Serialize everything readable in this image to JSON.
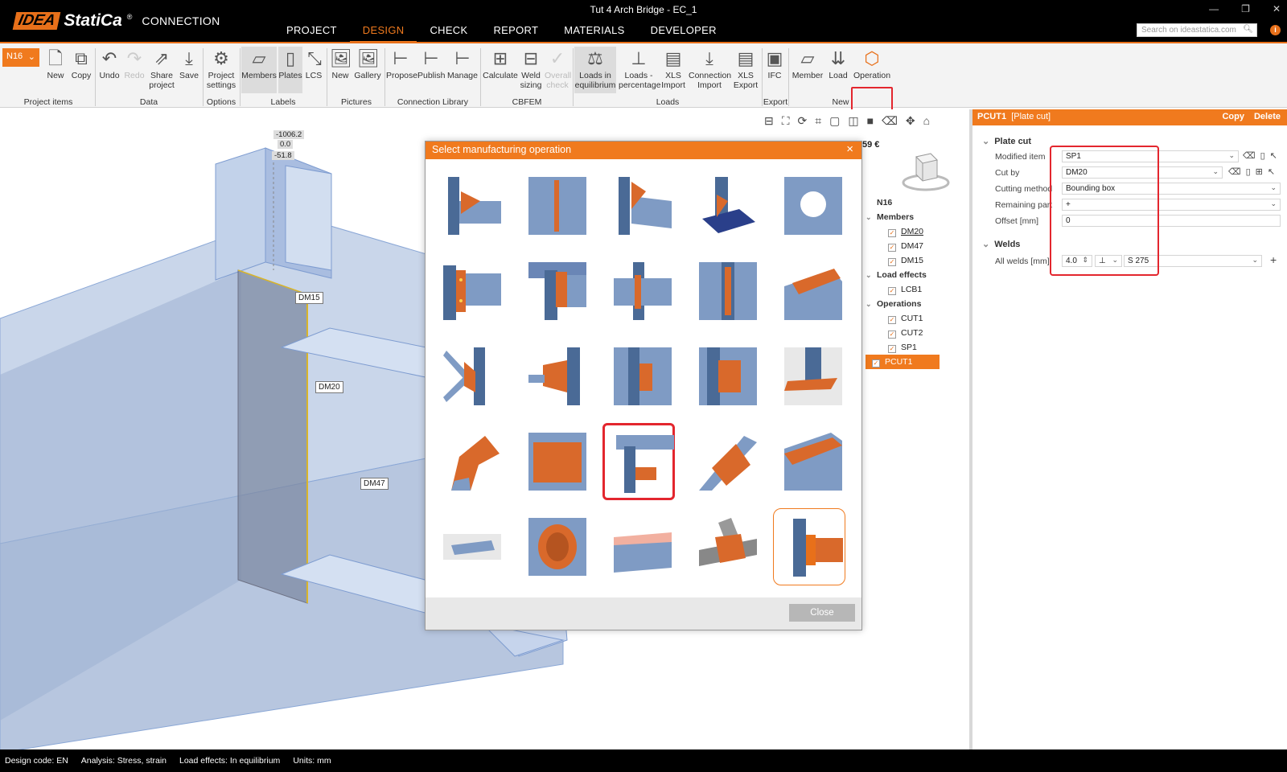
{
  "app": {
    "logo": "IDEA",
    "logo_statica": "StatiCa",
    "logo_reg": "®",
    "product": "CONNECTION",
    "window_title": "Tut 4 Arch Bridge - EC_1",
    "window_controls": [
      "—",
      "❐",
      "✕"
    ]
  },
  "menu": {
    "items": [
      "PROJECT",
      "DESIGN",
      "CHECK",
      "REPORT",
      "MATERIALS",
      "DEVELOPER"
    ],
    "active": "DESIGN"
  },
  "search": {
    "placeholder": "Search on ideastatica.com"
  },
  "ribbon": {
    "node_selector": "N16",
    "buttons": {
      "new": "New",
      "copy": "Copy",
      "undo": "Undo",
      "redo": "Redo",
      "share": "Share project",
      "save": "Save",
      "project_settings": "Project settings",
      "members": "Members",
      "plates": "Plates",
      "lcs": "LCS",
      "pic_new": "New",
      "gallery": "Gallery",
      "propose": "Propose",
      "publish": "Publish",
      "manage": "Manage",
      "calculate": "Calculate",
      "weld_sizing": "Weld sizing",
      "overall_check": "Overall check",
      "loads_eq": "Loads in equilibrium",
      "loads_pct": "Loads - percentage",
      "xls_import": "XLS Import",
      "conn_import": "Connection Import",
      "xls_export": "XLS Export",
      "ifc": "IFC",
      "member": "Member",
      "load": "Load",
      "operation": "Operation"
    },
    "groups": [
      "Project items",
      "Data",
      "Options",
      "Labels",
      "Pictures",
      "Connection Library",
      "CBFEM",
      "Loads",
      "Export",
      "New"
    ]
  },
  "viewport": {
    "labels": [
      "DM15",
      "DM20",
      "DM47"
    ],
    "dims": [
      "-1006.2",
      "0.0",
      "-51.8"
    ],
    "price": "59 €"
  },
  "tree": {
    "root": "N16",
    "sections": [
      {
        "title": "Members",
        "items": [
          "DM20",
          "DM47",
          "DM15"
        ]
      },
      {
        "title": "Load effects",
        "items": [
          "LCB1"
        ]
      },
      {
        "title": "Operations",
        "items": [
          "CUT1",
          "CUT2",
          "SP1",
          "PCUT1"
        ]
      }
    ],
    "selected": "PCUT1"
  },
  "props": {
    "id": "PCUT1",
    "type": "[Plate cut]",
    "copy": "Copy",
    "delete": "Delete",
    "section_plate": "Plate cut",
    "section_welds": "Welds",
    "rows": {
      "modified_item": {
        "label": "Modified item",
        "value": "SP1"
      },
      "cut_by": {
        "label": "Cut by",
        "value": "DM20"
      },
      "cutting_method": {
        "label": "Cutting method",
        "value": "Bounding box"
      },
      "remaining_part": {
        "label": "Remaining part",
        "value": "+"
      },
      "offset": {
        "label": "Offset [mm]",
        "value": "0"
      },
      "all_welds": {
        "label": "All welds [mm]",
        "value": "4.0",
        "material": "S 275"
      }
    }
  },
  "dialog": {
    "title": "Select manufacturing operation",
    "close_label": "Close"
  },
  "status": {
    "design_code": "Design code: EN",
    "analysis": "Analysis: Stress, strain",
    "load_effects": "Load effects: In equilibrium",
    "units": "Units: mm"
  },
  "colors": {
    "accent": "#f07a1e",
    "highlight": "#e3262e",
    "steel": "#7f9bc4",
    "plate": "#d9692b"
  }
}
